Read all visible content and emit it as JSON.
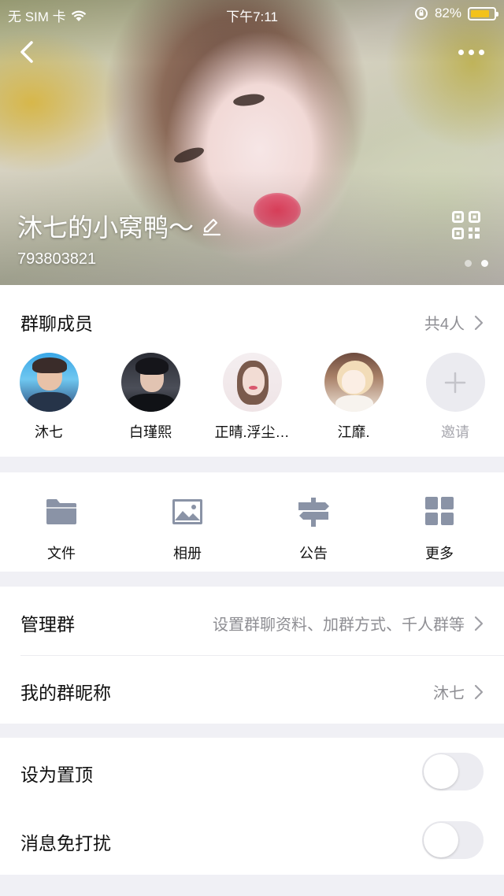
{
  "status_bar": {
    "carrier": "无 SIM 卡",
    "time": "下午7:11",
    "battery": "82%",
    "battery_level": 0.82
  },
  "header": {
    "group_name": "沐七的小窝鸭～",
    "group_id": "793803821",
    "carousel_pages": 2,
    "carousel_active": 1
  },
  "members": {
    "title": "群聊成员",
    "count_text": "共4人",
    "list": [
      {
        "name": "沐七"
      },
      {
        "name": "白瑾熙"
      },
      {
        "name": "正晴.浮尘…"
      },
      {
        "name": "江靡."
      }
    ],
    "invite_label": "邀请"
  },
  "tools": [
    {
      "label": "文件",
      "icon": "folder-icon"
    },
    {
      "label": "相册",
      "icon": "image-icon"
    },
    {
      "label": "公告",
      "icon": "signpost-icon"
    },
    {
      "label": "更多",
      "icon": "grid-icon"
    }
  ],
  "settings": {
    "manage": {
      "label": "管理群",
      "hint": "设置群聊资料、加群方式、千人群等"
    },
    "nickname": {
      "label": "我的群昵称",
      "value": "沐七"
    }
  },
  "toggles": {
    "pin": {
      "label": "设为置顶",
      "on": false
    },
    "mute": {
      "label": "消息免打扰",
      "on": false
    }
  },
  "colors": {
    "accent_battery": "#f3c21a",
    "muted_text": "#8e8e93",
    "toggle_off": "#ececf1"
  }
}
